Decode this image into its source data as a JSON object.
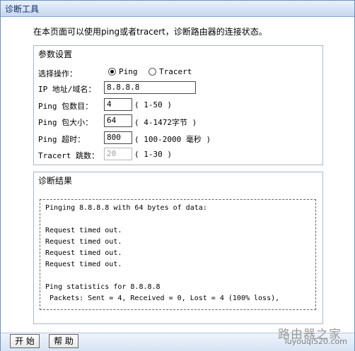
{
  "window": {
    "title": "诊断工具"
  },
  "intro_text": "在本页面可以使用ping或者tracert，诊断路由器的连接状态。",
  "settings": {
    "legend": "参数设置",
    "operation_label": "选择操作：",
    "operation_options": [
      {
        "label": "Ping",
        "selected": true
      },
      {
        "label": "Tracert",
        "selected": false
      }
    ],
    "ip_label": "IP 地址/域名：",
    "ip_value": "8.8.8.8",
    "ping_count_label": "Ping 包数目：",
    "ping_count_value": "4",
    "ping_count_hint": "( 1-50 )",
    "ping_size_label": "Ping 包大小：",
    "ping_size_value": "64",
    "ping_size_hint": "( 4-1472字节 )",
    "ping_timeout_label": "Ping 超时：",
    "ping_timeout_value": "800",
    "ping_timeout_hint": "( 100-2000 毫秒 )",
    "tracert_hops_label": "Tracert 跳数：",
    "tracert_hops_value": "20",
    "tracert_hops_hint": "( 1-30 )"
  },
  "results": {
    "legend": "诊断结果",
    "lines": [
      "Pinging 8.8.8.8 with 64 bytes of data:",
      "",
      "Request timed out.",
      "Request timed out.",
      "Request timed out.",
      "Request timed out.",
      "",
      "Ping statistics for 8.8.8.8",
      " Packets: Sent = 4, Received = 0, Lost = 4 (100% loss),"
    ]
  },
  "buttons": {
    "start": "开 始",
    "help": "帮 助"
  },
  "watermark": {
    "name": "路由器之家",
    "url": "luyouqi520.com"
  }
}
